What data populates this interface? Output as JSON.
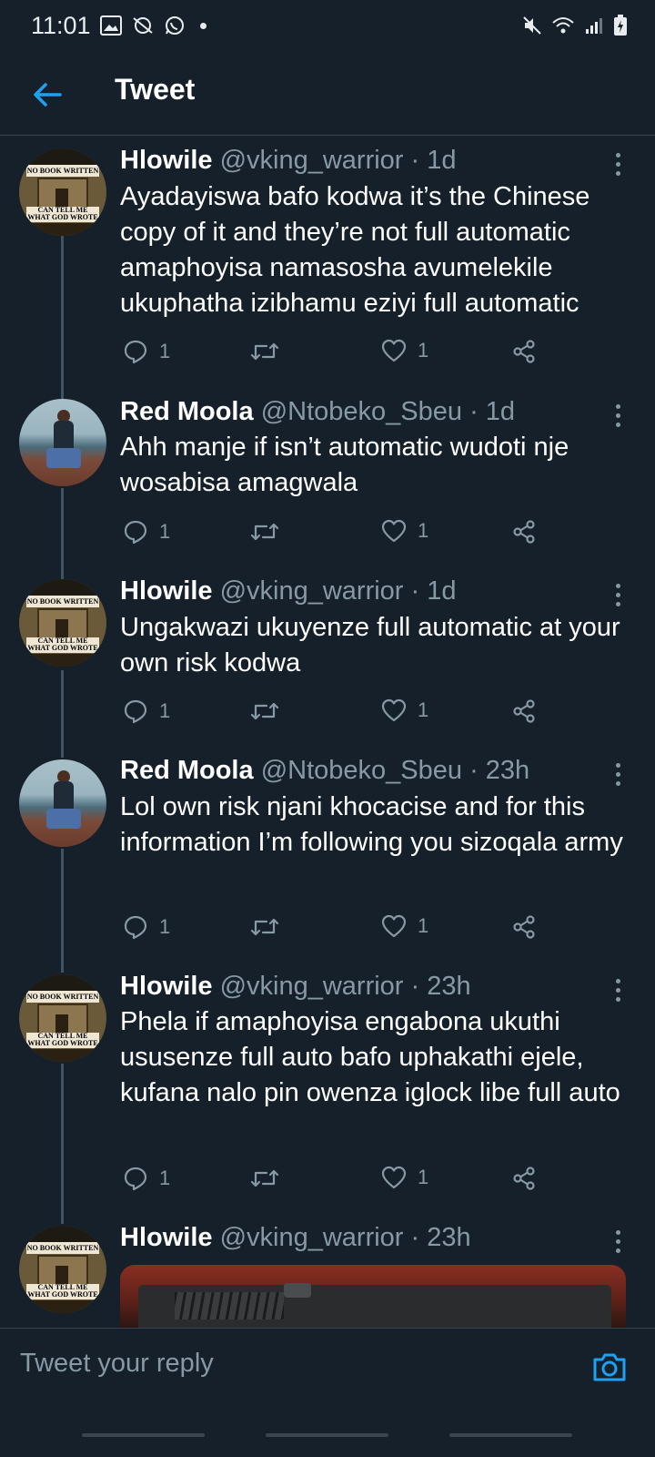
{
  "status_bar": {
    "time": "11:01"
  },
  "app_bar": {
    "title": "Tweet"
  },
  "colors": {
    "background": "#15202b",
    "secondary_text": "#8899a6",
    "accent": "#1da1f2",
    "divider": "#38444d"
  },
  "tweets": [
    {
      "name": "Hlowile",
      "handle": "@vking_warrior",
      "time": "· 1d",
      "avatar": "book-avatar",
      "text": "Ayadayiswa bafo kodwa it’s the Chinese copy of it and they’re not full automatic amaphoyisa namasosha avumelekile ukuphatha izibhamu eziyi full automatic",
      "replies": "1",
      "likes": "1"
    },
    {
      "name": "Red Moola",
      "handle": "@Ntobeko_Sbeu",
      "time": "· 1d",
      "avatar": "person-avatar",
      "text": "Ahh manje if isn’t automatic wudoti nje wosabisa amagwala",
      "replies": "1",
      "likes": "1"
    },
    {
      "name": "Hlowile",
      "handle": "@vking_warrior",
      "time": "· 1d",
      "avatar": "book-avatar",
      "text": "Ungakwazi ukuyenze full automatic at your own risk kodwa",
      "replies": "1",
      "likes": "1"
    },
    {
      "name": "Red Moola",
      "handle": "@Ntobeko_Sbeu",
      "time": "· 23h",
      "avatar": "person-avatar",
      "text": "Lol own risk njani khocacise and for this information I’m following you sizoqala army",
      "replies": "1",
      "likes": "1"
    },
    {
      "name": "Hlowile",
      "handle": "@vking_warrior",
      "time": "· 23h",
      "avatar": "book-avatar",
      "text": "Phela if amaphoyisa engabona ukuthi ususenze full auto bafo uphakathi ejele, kufana nalo pin owenza iglock libe full auto",
      "replies": "1",
      "likes": "1"
    },
    {
      "name": "Hlowile",
      "handle": "@vking_warrior",
      "time": "· 23h",
      "avatar": "book-avatar"
    }
  ],
  "avatar_book": {
    "top": "NO BOOK WRITTEN",
    "bottom": "CAN TELL ME WHAT GOD WROTE"
  },
  "reply_bar": {
    "placeholder": "Tweet your reply"
  }
}
